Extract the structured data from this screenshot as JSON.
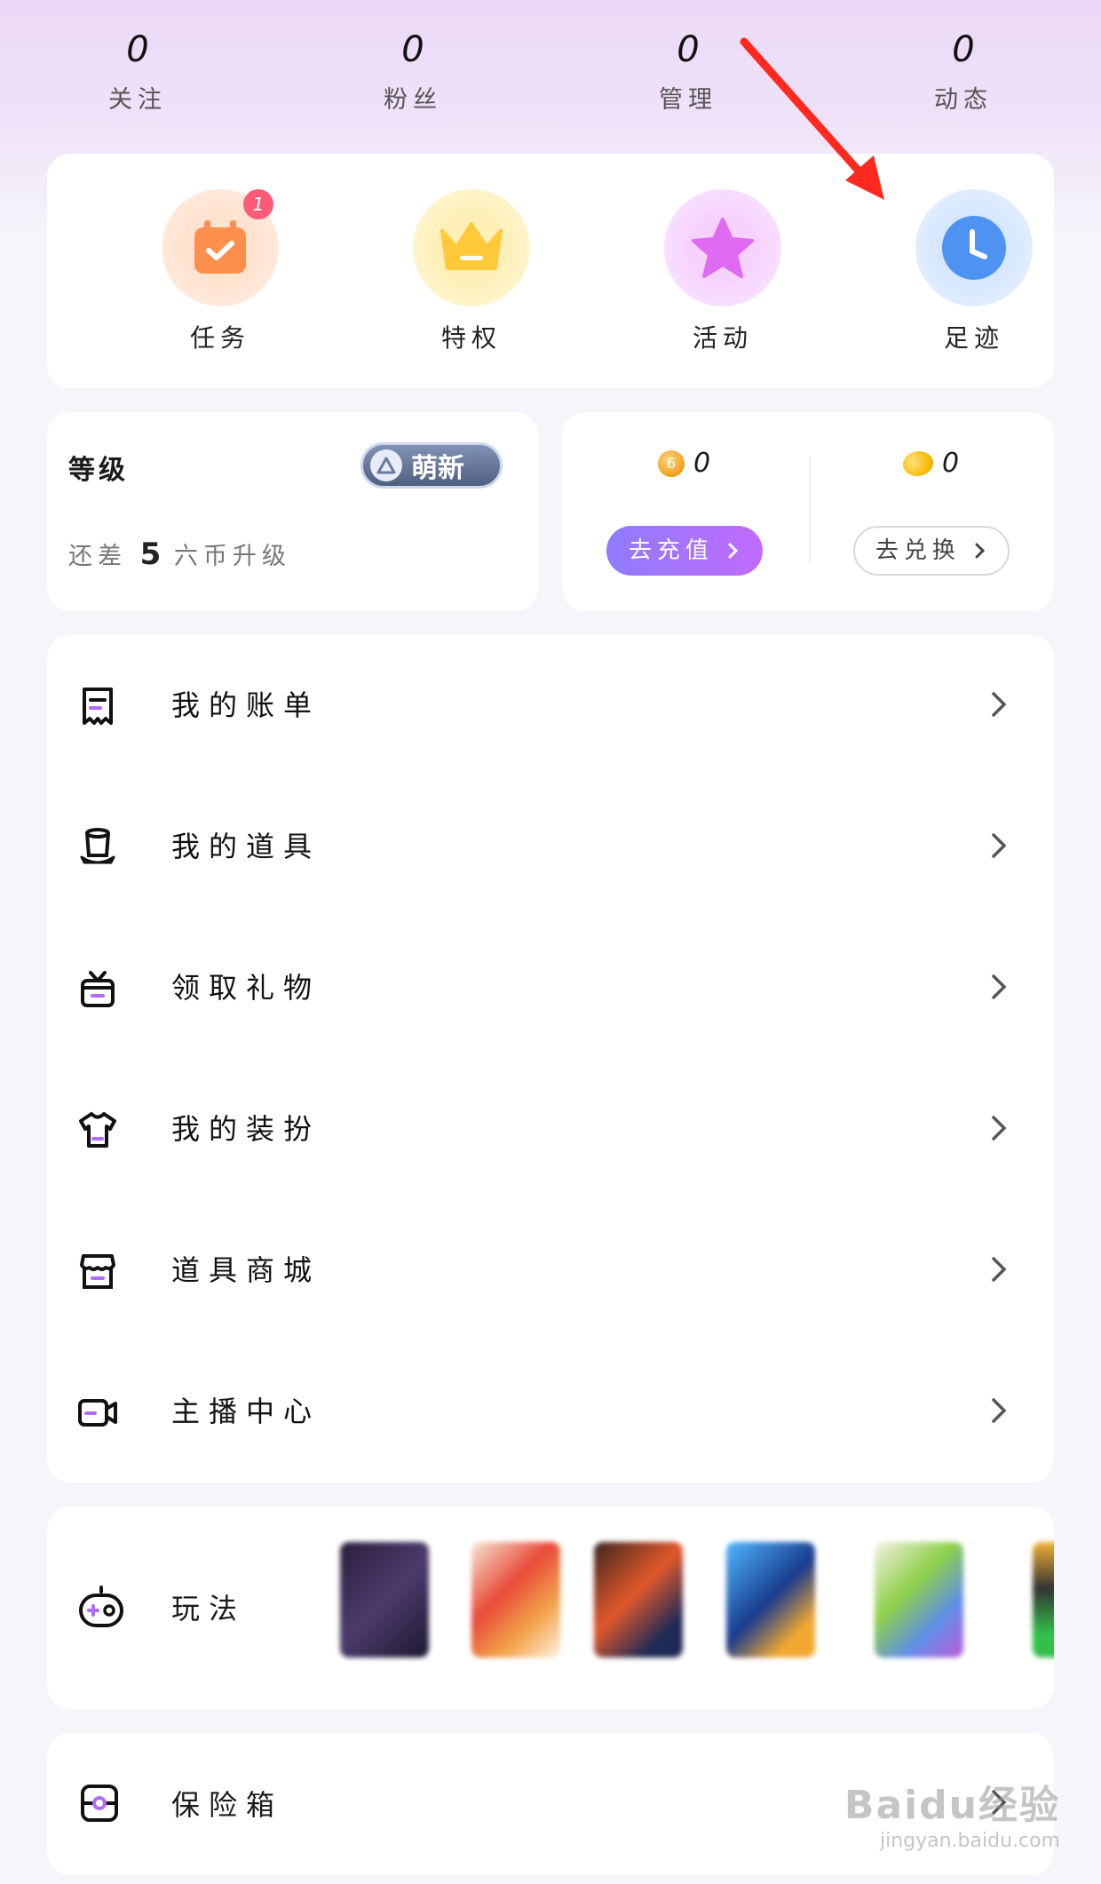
{
  "stats": [
    {
      "value": "0",
      "label": "关注"
    },
    {
      "value": "0",
      "label": "粉丝"
    },
    {
      "value": "0",
      "label": "管理"
    },
    {
      "value": "0",
      "label": "动态"
    }
  ],
  "quick_actions": [
    {
      "label": "任务",
      "icon": "calendar-check-icon",
      "badge": "1"
    },
    {
      "label": "特权",
      "icon": "crown-icon"
    },
    {
      "label": "活动",
      "icon": "star-icon"
    },
    {
      "label": "足迹",
      "icon": "clock-icon"
    }
  ],
  "level": {
    "title": "等级",
    "badge": "萌新",
    "hint_prefix": "还差",
    "hint_amount": "5",
    "hint_suffix": "六币升级"
  },
  "wallet": {
    "coin_value": "0",
    "coin_symbol": "6",
    "bean_value": "0",
    "recharge_label": "去充值",
    "exchange_label": "去兑换"
  },
  "menu": [
    {
      "label": "我的账单",
      "icon": "receipt-icon"
    },
    {
      "label": "我的道具",
      "icon": "top-hat-icon"
    },
    {
      "label": "领取礼物",
      "icon": "gift-icon"
    },
    {
      "label": "我的装扮",
      "icon": "shirt-icon"
    },
    {
      "label": "道具商城",
      "icon": "store-icon"
    },
    {
      "label": "主播中心",
      "icon": "video-camera-icon"
    }
  ],
  "games": {
    "label": "玩法",
    "icon": "gamepad-icon"
  },
  "safe": {
    "label": "保险箱",
    "icon": "safe-icon"
  },
  "watermark": {
    "line1": "Baidu经验",
    "line2": "jingyan.baidu.com"
  },
  "colors": {
    "accent": "#9b6dff",
    "badge_red": "#ff5a78",
    "arrow_red": "#ff2a1f"
  }
}
